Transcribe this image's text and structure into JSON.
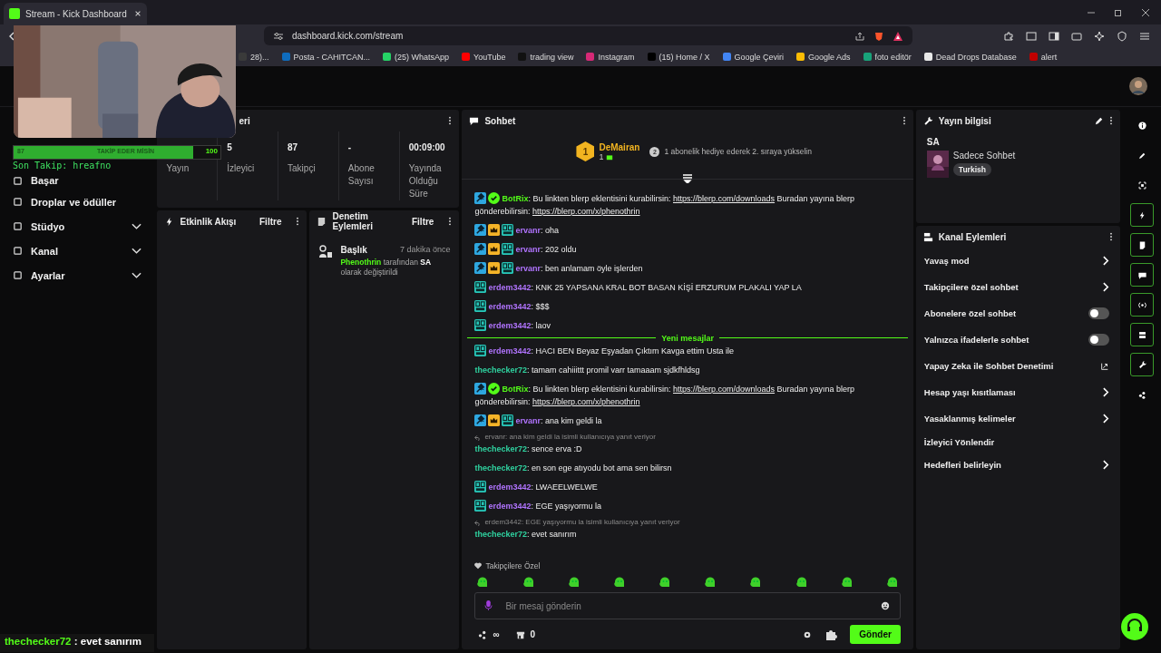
{
  "browser": {
    "tab_title": "Stream - Kick Dashboard",
    "url": "dashboard.kick.com/stream",
    "bookmarks": [
      {
        "label": "28)...",
        "color": "#3a3a3a"
      },
      {
        "label": "Posta - CAHITCAN...",
        "color": "#0f6cbd"
      },
      {
        "label": "(25) WhatsApp",
        "color": "#25d366"
      },
      {
        "label": "YouTube",
        "color": "#ff0000"
      },
      {
        "label": "trading view",
        "color": "#111111"
      },
      {
        "label": "Instagram",
        "color": "#d62976"
      },
      {
        "label": "(15) Home / X",
        "color": "#000000"
      },
      {
        "label": "Google Çeviri",
        "color": "#4285f4"
      },
      {
        "label": "Google Ads",
        "color": "#fbbc04"
      },
      {
        "label": "foto editör",
        "color": "#18a37a"
      },
      {
        "label": "Dead Drops Database",
        "color": "#e8e8e8"
      },
      {
        "label": "alert",
        "color": "#c00000"
      }
    ]
  },
  "overlay": {
    "follow_goal": {
      "count": "87",
      "label": "TAKİP EDER MİSİN",
      "target": "100",
      "level": 0.87
    },
    "last_follow": "Son Takip: hreafno",
    "chat_line": {
      "user": "thechecker72",
      "text": " : evet sanırım"
    }
  },
  "sidebar": {
    "items": [
      {
        "label": "Başar",
        "expandable": false
      },
      {
        "label": "Droplar ve ödüller",
        "expandable": false
      },
      {
        "label": "Stüdyo",
        "expandable": true
      },
      {
        "label": "Kanal",
        "expandable": true
      },
      {
        "label": "Ayarlar",
        "expandable": true
      }
    ]
  },
  "stats": {
    "title": "eri",
    "items": [
      {
        "label": "Yayın"
      },
      {
        "value": "5",
        "label": "İzleyici"
      },
      {
        "value": "87",
        "label": "Takipçi"
      },
      {
        "value": "-",
        "label": "Abone Sayısı"
      },
      {
        "value": "00:09:00",
        "label": "Yayında Olduğu Süre"
      }
    ]
  },
  "activity_feed": {
    "title": "Etkinlik Akışı",
    "filter": "Filtre"
  },
  "moderation": {
    "title": "Denetim Eylemleri",
    "filter": "Filtre",
    "entries": [
      {
        "title": "Başlık",
        "time": "7 dakika önce",
        "actor": "Phenothrin",
        "middle": " tarafından ",
        "value": "SA",
        "tail": " olarak değiştirildi"
      }
    ]
  },
  "chat": {
    "title": "Sohbet",
    "leader": {
      "rank": "1",
      "name": "DeMairan",
      "gifts": "1",
      "next_rank": "2",
      "hint": "1 abonelik hediye ederek 2. sıraya yükselin"
    },
    "new_messages_label": "Yeni mesajlar",
    "messages": [
      {
        "kind": "message",
        "badges": [
          {
            "kind": "mod"
          },
          {
            "kind": "verified"
          }
        ],
        "user": "BotRix",
        "color": "#53fc18",
        "parts": [
          {
            "text": ": Bu linkten blerp eklentisini kurabilirsin: ",
            "link": false
          },
          {
            "text": "https://blerp.com/downloads",
            "link": true
          },
          {
            "text": " Buradan yayına blerp gönderebilirsin: ",
            "link": false
          },
          {
            "text": "https://blerp.com/x/phenothrin",
            "link": true
          }
        ]
      },
      {
        "kind": "message",
        "badges": [
          {
            "kind": "mod"
          },
          {
            "kind": "vip"
          },
          {
            "kind": "og"
          }
        ],
        "user": "ervanr",
        "color": "#b174ff",
        "parts": [
          {
            "text": ": oha",
            "link": false
          }
        ]
      },
      {
        "kind": "message",
        "badges": [
          {
            "kind": "mod"
          },
          {
            "kind": "vip"
          },
          {
            "kind": "og"
          }
        ],
        "user": "ervanr",
        "color": "#b174ff",
        "parts": [
          {
            "text": ": 202 oldu",
            "link": false
          }
        ]
      },
      {
        "kind": "message",
        "badges": [
          {
            "kind": "mod"
          },
          {
            "kind": "vip"
          },
          {
            "kind": "og"
          }
        ],
        "user": "ervanr",
        "color": "#b174ff",
        "parts": [
          {
            "text": ": ben anlamam öyle işlerden",
            "link": false
          }
        ]
      },
      {
        "kind": "message",
        "badges": [
          {
            "kind": "og"
          }
        ],
        "user": "erdem3442",
        "color": "#b174ff",
        "parts": [
          {
            "text": ": KNK 25 YAPSANA KRAL BOT BASAN KİŞİ ERZURUM PLAKALI YAP LA",
            "link": false
          }
        ]
      },
      {
        "kind": "message",
        "badges": [
          {
            "kind": "og"
          }
        ],
        "user": "erdem3442",
        "color": "#b174ff",
        "parts": [
          {
            "text": ": $$$",
            "link": false
          }
        ]
      },
      {
        "kind": "message",
        "badges": [
          {
            "kind": "og"
          }
        ],
        "user": "erdem3442",
        "color": "#b174ff",
        "parts": [
          {
            "text": ": laov",
            "link": false
          }
        ]
      },
      {
        "kind": "divider"
      },
      {
        "kind": "message",
        "badges": [
          {
            "kind": "og"
          }
        ],
        "user": "erdem3442",
        "color": "#b174ff",
        "parts": [
          {
            "text": ": HACI BEN Beyaz Eşyadan Çıktım Kavga ettim Usta ile",
            "link": false
          }
        ]
      },
      {
        "kind": "message",
        "user": "thechecker72",
        "color": "#2fd3a0",
        "parts": [
          {
            "text": ": tamam cahiiittt promil varr tamaaam sjdkfhldsg",
            "link": false
          }
        ]
      },
      {
        "kind": "message",
        "badges": [
          {
            "kind": "mod"
          },
          {
            "kind": "verified"
          }
        ],
        "user": "BotRix",
        "color": "#53fc18",
        "parts": [
          {
            "text": ": Bu linkten blerp eklentisini kurabilirsin: ",
            "link": false
          },
          {
            "text": "https://blerp.com/downloads",
            "link": true
          },
          {
            "text": " Buradan yayına blerp gönderebilirsin: ",
            "link": false
          },
          {
            "text": "https://blerp.com/x/phenothrin",
            "link": true
          }
        ]
      },
      {
        "kind": "message",
        "badges": [
          {
            "kind": "mod"
          },
          {
            "kind": "vip"
          },
          {
            "kind": "og"
          }
        ],
        "user": "ervanr",
        "color": "#b174ff",
        "parts": [
          {
            "text": ": ana kim geldi la",
            "link": false
          }
        ]
      },
      {
        "kind": "reply",
        "text": "ervanr: ana kim geldi la isimli kullanıcıya yanıt veriyor"
      },
      {
        "kind": "message",
        "user": "thechecker72",
        "color": "#2fd3a0",
        "parts": [
          {
            "text": ": sence erva :D",
            "link": false
          }
        ]
      },
      {
        "kind": "message",
        "user": "thechecker72",
        "color": "#2fd3a0",
        "parts": [
          {
            "text": ": en son ege atıyodu bot ama sen bilirsn",
            "link": false
          }
        ]
      },
      {
        "kind": "message",
        "badges": [
          {
            "kind": "og"
          }
        ],
        "user": "erdem3442",
        "color": "#b174ff",
        "parts": [
          {
            "text": ": LWAEELWELWE",
            "link": false
          }
        ]
      },
      {
        "kind": "message",
        "badges": [
          {
            "kind": "og"
          }
        ],
        "user": "erdem3442",
        "color": "#b174ff",
        "parts": [
          {
            "text": ": EGE yaşıyormu la",
            "link": false
          }
        ]
      },
      {
        "kind": "reply",
        "text": "erdem3442: EGE yaşıyormu la isimli kullanıcıya yanıt veriyor"
      },
      {
        "kind": "message",
        "user": "thechecker72",
        "color": "#2fd3a0",
        "parts": [
          {
            "text": ": evet sanırım",
            "link": false
          }
        ]
      }
    ],
    "emote_section": "Takipçilere Özel",
    "input": {
      "placeholder": "Bir mesaj gönderin"
    },
    "points": "∞",
    "shop_count": "0",
    "send": "Gönder"
  },
  "stream_info": {
    "title": "Yayın bilgisi",
    "stream_title": "SA",
    "category": "Sadece Sohbet",
    "tag": "Turkish"
  },
  "channel_actions": {
    "title": "Kanal Eylemleri",
    "items": [
      {
        "label": "Yavaş mod",
        "kind": "chevron"
      },
      {
        "label": "Takipçilere özel sohbet",
        "kind": "chevron"
      },
      {
        "label": "Abonelere özel sohbet",
        "kind": "toggle",
        "on": false
      },
      {
        "label": "Yalnızca ifadelerle sohbet",
        "kind": "toggle",
        "on": false
      },
      {
        "label": "Yapay Zeka ile Sohbet Denetimi",
        "kind": "external"
      },
      {
        "label": "Hesap yaşı kısıtlaması",
        "kind": "chevron"
      },
      {
        "label": "Yasaklanmış kelimeler",
        "kind": "chevron"
      },
      {
        "label": "İzleyici Yönlendir",
        "kind": "plain"
      },
      {
        "label": "Hedefleri belirleyin",
        "kind": "chevron"
      }
    ]
  },
  "rail": [
    {
      "kind": "info",
      "active": false
    },
    {
      "kind": "edit",
      "active": false
    },
    {
      "kind": "focus",
      "active": false
    },
    {
      "kind": "bolt",
      "active": true
    },
    {
      "kind": "note",
      "active": true
    },
    {
      "kind": "chat",
      "active": true
    },
    {
      "kind": "broadcast",
      "active": true
    },
    {
      "kind": "layout",
      "active": true
    },
    {
      "kind": "wrench",
      "active": true
    },
    {
      "kind": "dots",
      "active": false
    }
  ]
}
